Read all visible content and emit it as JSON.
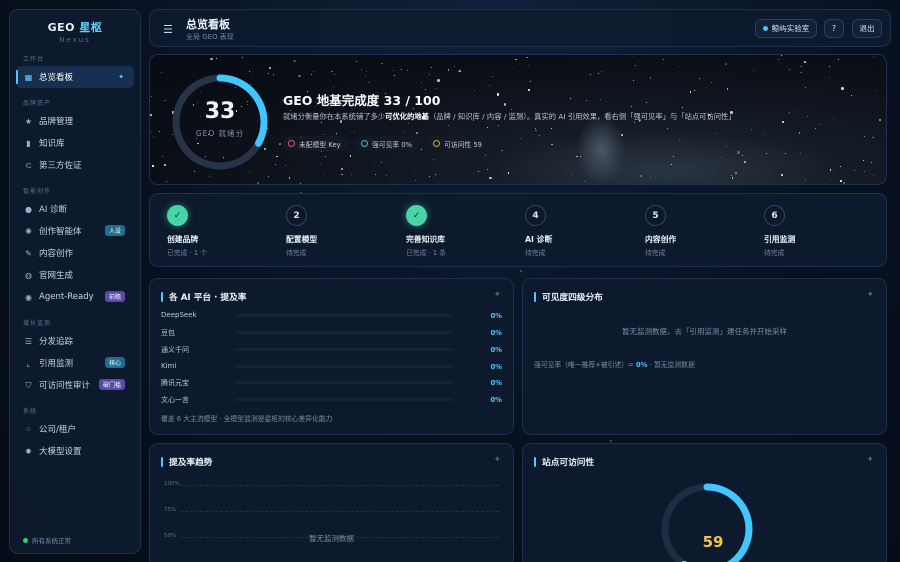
{
  "app": {
    "name_prefix": "GEO",
    "name_accent": "星枢",
    "sub": "Nexus"
  },
  "sidebar": {
    "sections": [
      {
        "title": "工作台",
        "items": [
          {
            "label": "总览看板",
            "icon": "grid-icon",
            "active": true
          }
        ]
      },
      {
        "title": "品牌资产",
        "items": [
          {
            "label": "品牌管理",
            "icon": "star-icon"
          },
          {
            "label": "知识库",
            "icon": "book-icon"
          },
          {
            "label": "第三方佐证",
            "icon": "link-icon"
          }
        ]
      },
      {
        "title": "智能创作",
        "items": [
          {
            "label": "AI 诊断",
            "icon": "info-icon"
          },
          {
            "label": "创作智能体",
            "icon": "sparkle-icon",
            "badge": "人设"
          },
          {
            "label": "内容创作",
            "icon": "pen-icon"
          },
          {
            "label": "官网生成",
            "icon": "globe-icon"
          },
          {
            "label": "Agent-Ready",
            "icon": "robot-icon",
            "badge": "前瞻"
          }
        ]
      },
      {
        "title": "增长监测",
        "items": [
          {
            "label": "分发追踪",
            "icon": "list-icon"
          },
          {
            "label": "引用监测",
            "icon": "chart-icon",
            "badge": "核心"
          },
          {
            "label": "可访问性审计",
            "icon": "shield-icon",
            "badge": "破门槛"
          }
        ]
      },
      {
        "title": "系统",
        "items": [
          {
            "label": "公司/租户",
            "icon": "building-icon"
          },
          {
            "label": "大模型设置",
            "icon": "gear-icon"
          }
        ]
      }
    ],
    "status": "所有系统正常"
  },
  "topbar": {
    "title": "总览看板",
    "subtitle": "全局 GEO 表现",
    "lab": "鲸屿实验室",
    "help": "?",
    "logout": "退出"
  },
  "hero": {
    "score": "33",
    "score_label": "GEO 就绪分",
    "score_value": 33,
    "title": "GEO 地基完成度 33 / 100",
    "desc_pre": "就绪分衡量你在本系统铺了多少",
    "desc_bold": "可优化的地基",
    "desc_post": "（品牌 / 知识库 / 内容 / 监测）。真实的 AI 引用效果，看右侧「强可见率」与「站点可访问性」",
    "chips": [
      {
        "label": "未配模型 Key",
        "color": "#e0506e"
      },
      {
        "label": "强可见率 0%",
        "color": "#3fb8e0"
      },
      {
        "label": "可访问性 59",
        "color": "#e0a03a"
      }
    ]
  },
  "steps": [
    {
      "num": "",
      "done": true,
      "name": "创建品牌",
      "status": "已完成 · 1 个"
    },
    {
      "num": "2",
      "done": false,
      "name": "配置模型",
      "status": "待完成"
    },
    {
      "num": "",
      "done": true,
      "name": "完善知识库",
      "status": "已完成 · 1 条"
    },
    {
      "num": "4",
      "done": false,
      "name": "AI 诊断",
      "status": "待完成"
    },
    {
      "num": "5",
      "done": false,
      "name": "内容创作",
      "status": "待完成"
    },
    {
      "num": "6",
      "done": false,
      "name": "引用监测",
      "status": "待完成"
    }
  ],
  "platform_panel": {
    "title": "各 AI 平台 · 提及率",
    "rows": [
      {
        "name": "DeepSeek",
        "value": "0%"
      },
      {
        "name": "豆包",
        "value": "0%"
      },
      {
        "name": "通义千问",
        "value": "0%"
      },
      {
        "name": "Kimi",
        "value": "0%"
      },
      {
        "name": "腾讯元宝",
        "value": "0%"
      },
      {
        "name": "文心一言",
        "value": "0%"
      }
    ],
    "note": "覆盖 6 大主流模型 · 全模型监测是星枢的核心差异化能力"
  },
  "visibility_panel": {
    "title": "可见度四级分布",
    "empty": "暂无监测数据，去「引用监测」建任务并开始采样",
    "line_pre": "强可见率（唯一推荐+被引述）=",
    "line_value": "0%",
    "line_post": "· 暂无监测数据"
  },
  "trend_panel": {
    "title": "提及率趋势",
    "ticks": [
      "100%",
      "75%",
      "50%"
    ],
    "empty": "暂无监测数据"
  },
  "access_panel": {
    "title": "站点可访问性",
    "score": "59",
    "score_value": 59
  },
  "colors": {
    "accent": "#52c8ff",
    "done": "#46d4a8",
    "score": "#f0c64a"
  }
}
